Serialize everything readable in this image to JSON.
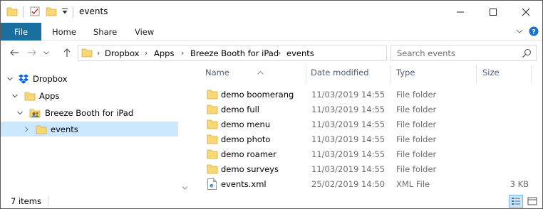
{
  "window": {
    "title": "events",
    "controls": {
      "minimize": "minimize",
      "maximize": "maximize",
      "close": "close"
    }
  },
  "ribbon": {
    "tabs": [
      {
        "label": "File"
      },
      {
        "label": "Home"
      },
      {
        "label": "Share"
      },
      {
        "label": "View"
      }
    ]
  },
  "address": {
    "crumbs": [
      "Dropbox",
      "Apps",
      "Breeze Booth for iPad",
      "events"
    ]
  },
  "search": {
    "placeholder": "Search events"
  },
  "nav_tree": [
    {
      "label": "Dropbox",
      "icon": "dropbox-icon",
      "expanded": true,
      "selected": false
    },
    {
      "label": "Apps",
      "icon": "folder-icon",
      "expanded": true,
      "selected": false
    },
    {
      "label": "Breeze Booth for iPad",
      "icon": "shared-folder-icon",
      "expanded": true,
      "selected": false
    },
    {
      "label": "events",
      "icon": "folder-icon",
      "expanded": false,
      "selected": true
    }
  ],
  "columns": {
    "name": "Name",
    "date": "Date modified",
    "type": "Type",
    "size": "Size"
  },
  "files": [
    {
      "name": "demo boomerang",
      "date": "11/03/2019 14:55",
      "type": "File folder",
      "size": "",
      "icon": "folder-icon"
    },
    {
      "name": "demo full",
      "date": "11/03/2019 14:55",
      "type": "File folder",
      "size": "",
      "icon": "folder-icon"
    },
    {
      "name": "demo menu",
      "date": "11/03/2019 14:55",
      "type": "File folder",
      "size": "",
      "icon": "folder-icon"
    },
    {
      "name": "demo photo",
      "date": "11/03/2019 14:55",
      "type": "File folder",
      "size": "",
      "icon": "folder-icon"
    },
    {
      "name": "demo roamer",
      "date": "11/03/2019 14:55",
      "type": "File folder",
      "size": "",
      "icon": "folder-icon"
    },
    {
      "name": "demo surveys",
      "date": "11/03/2019 14:55",
      "type": "File folder",
      "size": "",
      "icon": "folder-icon"
    },
    {
      "name": "events.xml",
      "date": "25/02/2019 14:50",
      "type": "XML File",
      "size": "3 KB",
      "icon": "xml-file-icon"
    }
  ],
  "status": {
    "item_count": "7 items"
  },
  "colors": {
    "file_tab": "#1b6f9e",
    "selection": "#cce8ff",
    "folder_yellow": "#f8d775",
    "folder_shade": "#e6b740",
    "header_text": "#4c607a"
  }
}
